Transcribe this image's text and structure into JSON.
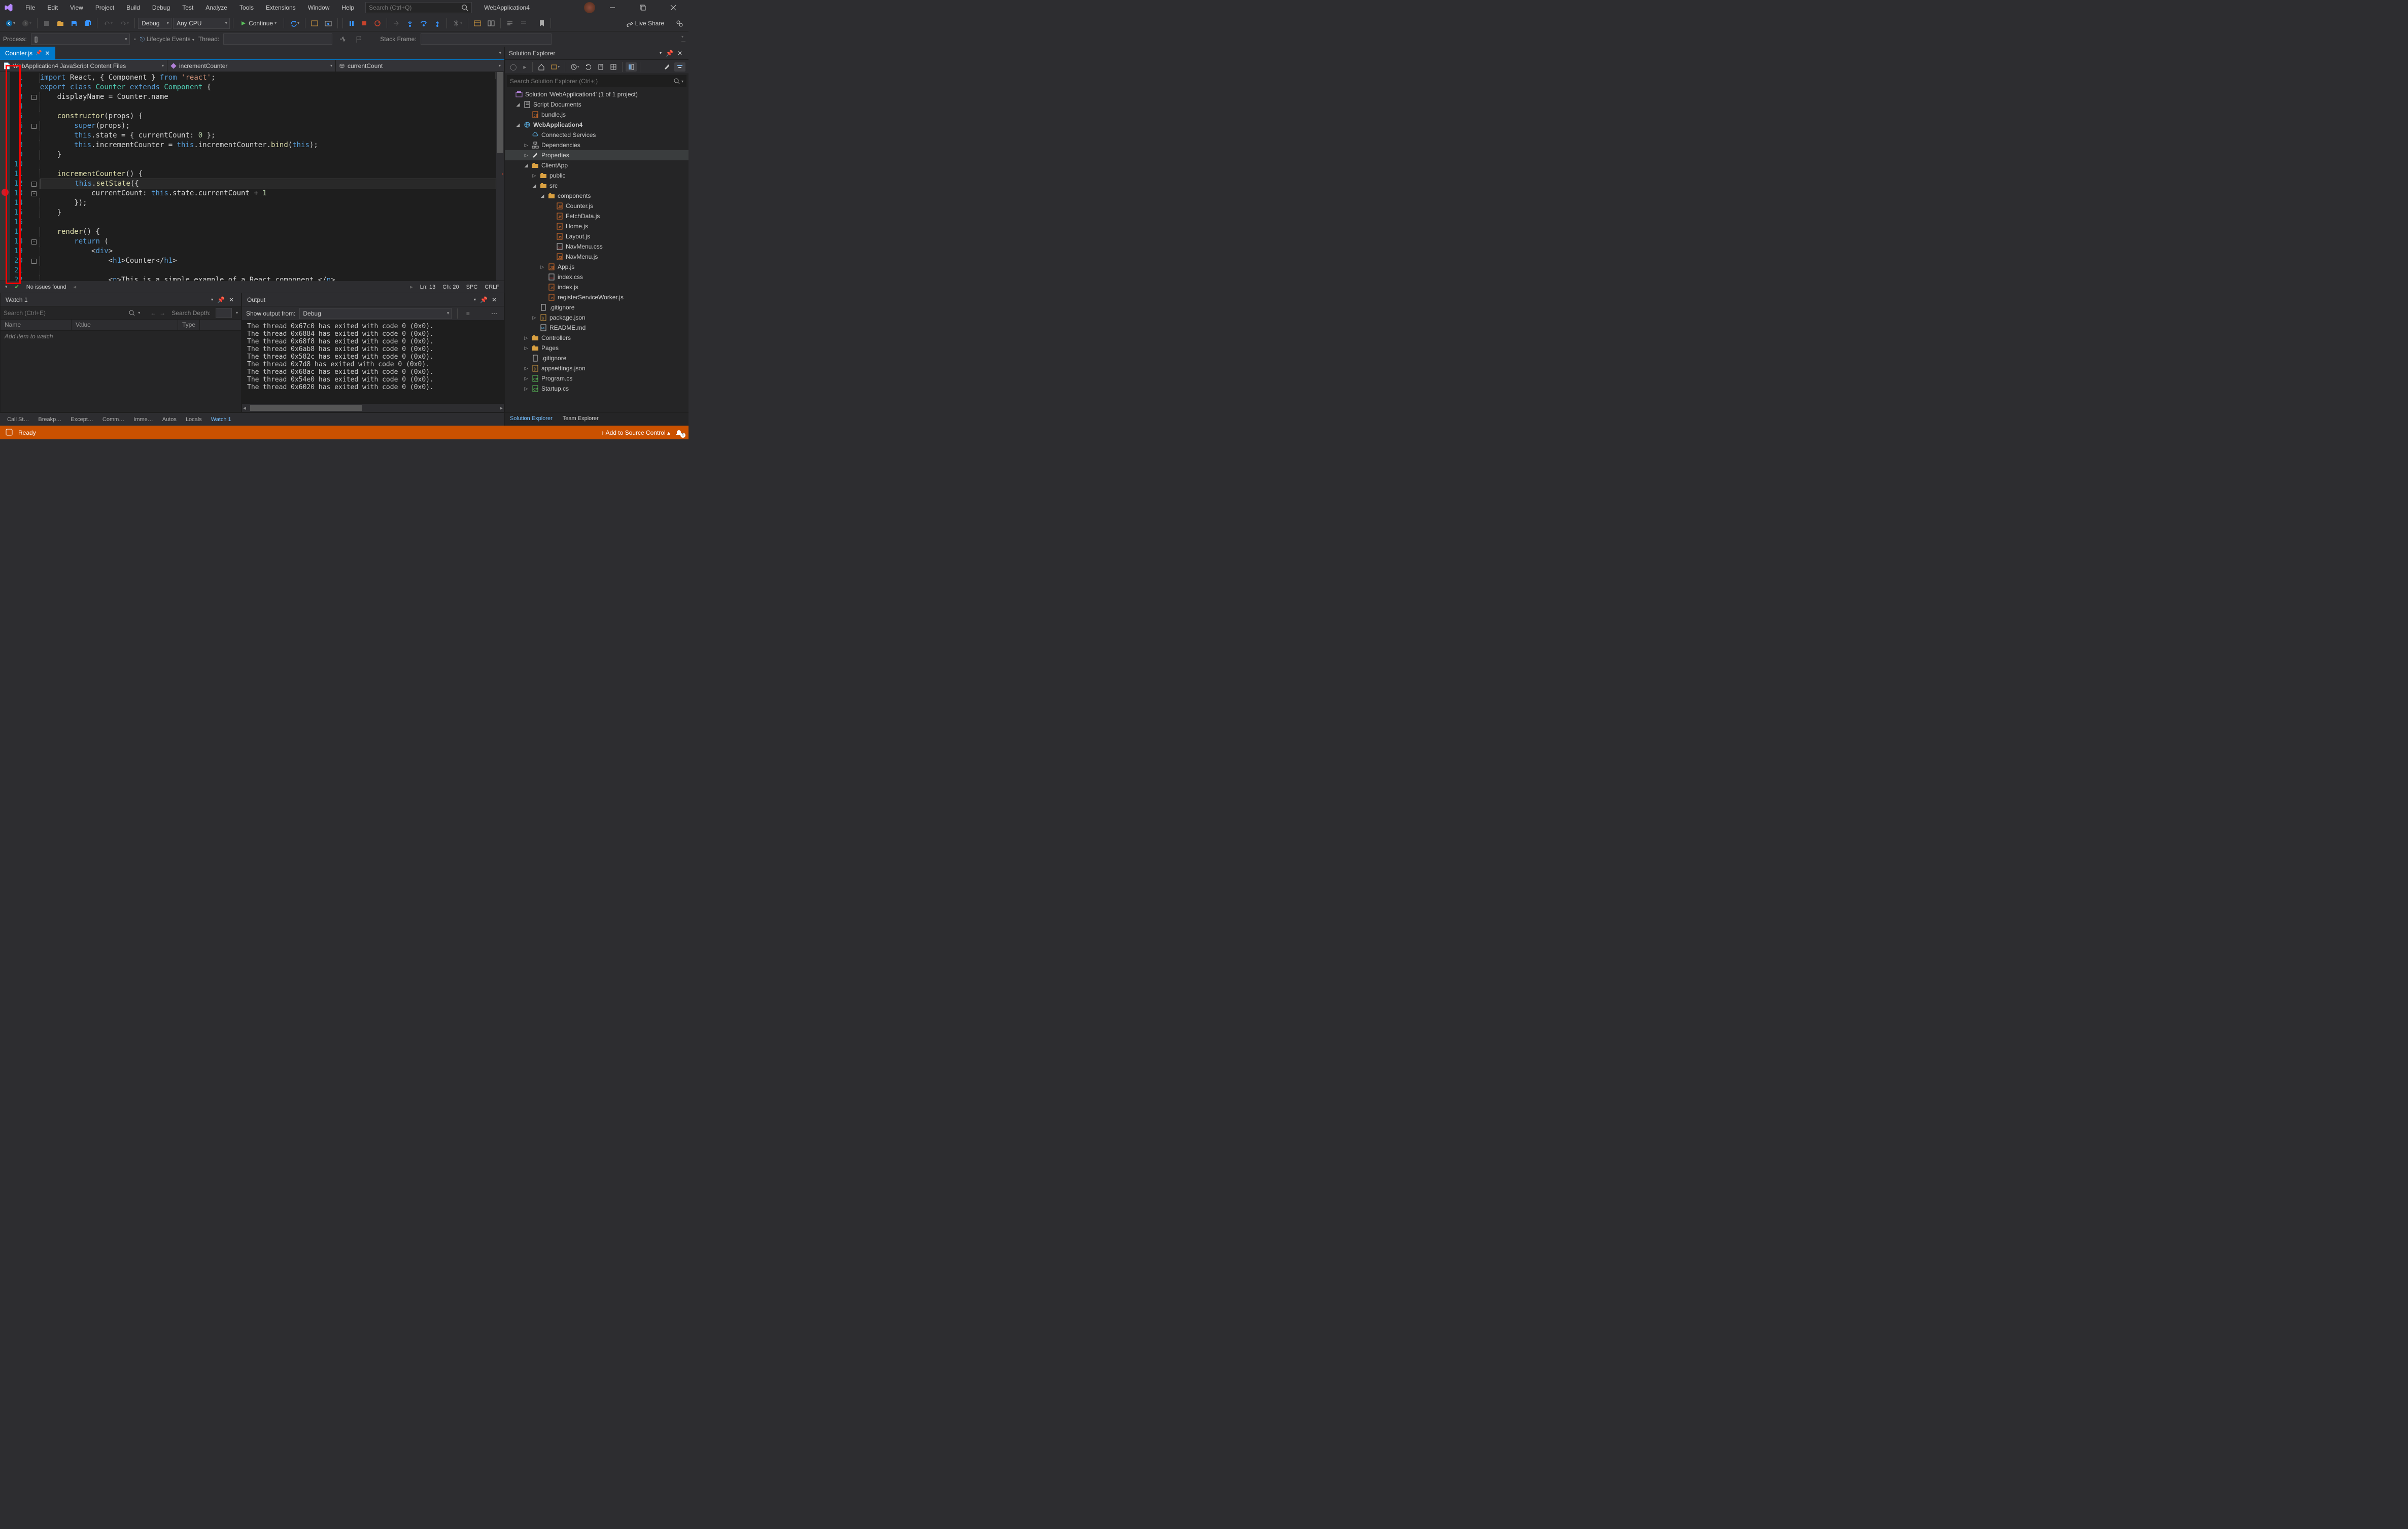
{
  "title": "WebApplication4",
  "menu": [
    "File",
    "Edit",
    "View",
    "Project",
    "Build",
    "Debug",
    "Test",
    "Analyze",
    "Tools",
    "Extensions",
    "Window",
    "Help"
  ],
  "searchPlaceholder": "Search (Ctrl+Q)",
  "toolbar": {
    "configuration": "Debug",
    "platform": "Any CPU",
    "runLabel": "Continue",
    "liveShare": "Live Share"
  },
  "debugBar": {
    "processLabel": "Process:",
    "processValue": "[]",
    "lifecycleLabel": "Lifecycle Events",
    "threadLabel": "Thread:",
    "stackLabel": "Stack Frame:"
  },
  "tab": {
    "name": "Counter.js"
  },
  "navBar": {
    "scope": "WebApplication4 JavaScript Content Files",
    "member": "incrementCounter",
    "field": "currentCount"
  },
  "code": {
    "lines": [
      {
        "n": 1,
        "html": "<span class='kw'>import</span> <span class='txt'>React, { Component }</span> <span class='kw'>from</span> <span class='str'>'react'</span><span class='txt'>;</span>",
        "indent": 0
      },
      {
        "n": 2,
        "html": "",
        "indent": 0
      },
      {
        "n": 3,
        "html": "<span class='kw'>export</span> <span class='kw'>class</span> <span class='type'>Counter</span> <span class='kw'>extends</span> <span class='type'>Component</span> <span class='txt'>{</span>",
        "indent": 0,
        "fold": true
      },
      {
        "n": 4,
        "html": "<span class='txt'>displayName = Counter.name</span>",
        "indent": 1
      },
      {
        "n": 5,
        "html": "",
        "indent": 1
      },
      {
        "n": 6,
        "html": "<span class='fn'>constructor</span><span class='txt'>(props) {</span>",
        "indent": 1,
        "fold": true
      },
      {
        "n": 7,
        "html": "<span class='kw'>super</span><span class='txt'>(props);</span>",
        "indent": 2
      },
      {
        "n": 8,
        "html": "<span class='kw'>this</span><span class='txt'>.state = { currentCount: </span><span class='num'>0</span><span class='txt'> };</span>",
        "indent": 2
      },
      {
        "n": 9,
        "html": "<span class='kw'>this</span><span class='txt'>.incrementCounter = </span><span class='kw'>this</span><span class='txt'>.incrementCounter.</span><span class='fn'>bind</span><span class='txt'>(</span><span class='kw'>this</span><span class='txt'>);</span>",
        "indent": 2
      },
      {
        "n": 10,
        "html": "<span class='txt'>}</span>",
        "indent": 1
      },
      {
        "n": 11,
        "html": "",
        "indent": 1
      },
      {
        "n": 12,
        "html": "<span class='fn'>incrementCounter</span><span class='txt'>() {</span>",
        "indent": 1,
        "fold": true
      },
      {
        "n": 13,
        "html": "<span class='kw'>this</span><span class='txt'>.</span><span class='fn'>setState</span><span class='txt'>({</span>",
        "indent": 2,
        "fold": true,
        "current": true,
        "breakpoint": true
      },
      {
        "n": 14,
        "html": "<span class='txt'>currentCount: </span><span class='kw'>this</span><span class='txt'>.state.currentCount + </span><span class='num'>1</span>",
        "indent": 3
      },
      {
        "n": 15,
        "html": "<span class='txt'>});</span>",
        "indent": 2
      },
      {
        "n": 16,
        "html": "<span class='txt'>}</span>",
        "indent": 1
      },
      {
        "n": 17,
        "html": "",
        "indent": 1
      },
      {
        "n": 18,
        "html": "<span class='fn'>render</span><span class='txt'>() {</span>",
        "indent": 1,
        "fold": true
      },
      {
        "n": 19,
        "html": "<span class='kw'>return</span> <span class='txt'>(</span>",
        "indent": 2
      },
      {
        "n": 20,
        "html": "<span class='txt'>&lt;</span><span class='tag'>div</span><span class='txt'>&gt;</span>",
        "indent": 3,
        "fold": true
      },
      {
        "n": 21,
        "html": "<span class='txt'>&lt;</span><span class='tag'>h1</span><span class='txt'>&gt;Counter&lt;/</span><span class='tag'>h1</span><span class='txt'>&gt;</span>",
        "indent": 4
      },
      {
        "n": 22,
        "html": "",
        "indent": 4
      },
      {
        "n": 23,
        "html": "<span class='txt'>&lt;</span><span class='tag'>n</span><span class='txt'>&gt;This is a simple example of a React component.&lt;/</span><span class='tag'>n</span><span class='txt'>&gt;</span>",
        "indent": 4
      }
    ]
  },
  "editorStatus": {
    "issues": "No issues found",
    "ln": "Ln: 13",
    "ch": "Ch: 20",
    "spc": "SPC",
    "eol": "CRLF"
  },
  "watch": {
    "title": "Watch 1",
    "searchPlaceholder": "Search (Ctrl+E)",
    "depthLabel": "Search Depth:",
    "cols": [
      "Name",
      "Value",
      "Type"
    ],
    "placeholder": "Add item to watch"
  },
  "output": {
    "title": "Output",
    "showLabel": "Show output from:",
    "source": "Debug",
    "lines": [
      "The thread 0x67c0 has exited with code 0 (0x0).",
      "The thread 0x6884 has exited with code 0 (0x0).",
      "The thread 0x68f8 has exited with code 0 (0x0).",
      "The thread 0x6ab8 has exited with code 0 (0x0).",
      "The thread 0x582c has exited with code 0 (0x0).",
      "The thread 0x7d8 has exited with code 0 (0x0).",
      "The thread 0x68ac has exited with code 0 (0x0).",
      "The thread 0x54e0 has exited with code 0 (0x0).",
      "The thread 0x6020 has exited with code 0 (0x0)."
    ]
  },
  "bottomTabs": [
    "Call St…",
    "Breakp…",
    "Except…",
    "Comm…",
    "Imme…",
    "Autos",
    "Locals",
    "Watch 1"
  ],
  "se": {
    "title": "Solution Explorer",
    "searchPlaceholder": "Search Solution Explorer (Ctrl+;)",
    "solution": "Solution 'WebApplication4' (1 of 1 project)",
    "tree": [
      {
        "d": 0,
        "exp": "▲",
        "icon": "sol",
        "label": "Solution 'WebApplication4' (1 of 1 project)",
        "hidden": true
      },
      {
        "d": 1,
        "exp": "▲",
        "icon": "script",
        "label": "Script Documents"
      },
      {
        "d": 2,
        "exp": "",
        "icon": "js",
        "label": "bundle.js"
      },
      {
        "d": 1,
        "exp": "▲",
        "icon": "globe",
        "label": "WebApplication4",
        "bold": true
      },
      {
        "d": 2,
        "exp": "",
        "icon": "cloud",
        "label": "Connected Services"
      },
      {
        "d": 2,
        "exp": "▷",
        "icon": "deps",
        "label": "Dependencies"
      },
      {
        "d": 2,
        "exp": "▷",
        "icon": "wrench",
        "label": "Properties",
        "sel": true
      },
      {
        "d": 2,
        "exp": "▲",
        "icon": "folder",
        "label": "ClientApp"
      },
      {
        "d": 3,
        "exp": "▷",
        "icon": "folder",
        "label": "public"
      },
      {
        "d": 3,
        "exp": "▲",
        "icon": "folder",
        "label": "src"
      },
      {
        "d": 4,
        "exp": "▲",
        "icon": "folder",
        "label": "components"
      },
      {
        "d": 5,
        "exp": "",
        "icon": "js",
        "label": "Counter.js"
      },
      {
        "d": 5,
        "exp": "",
        "icon": "js",
        "label": "FetchData.js"
      },
      {
        "d": 5,
        "exp": "",
        "icon": "js",
        "label": "Home.js"
      },
      {
        "d": 5,
        "exp": "",
        "icon": "js",
        "label": "Layout.js"
      },
      {
        "d": 5,
        "exp": "",
        "icon": "css",
        "label": "NavMenu.css"
      },
      {
        "d": 5,
        "exp": "",
        "icon": "js",
        "label": "NavMenu.js"
      },
      {
        "d": 4,
        "exp": "▷",
        "icon": "js",
        "label": "App.js"
      },
      {
        "d": 4,
        "exp": "",
        "icon": "css",
        "label": "index.css"
      },
      {
        "d": 4,
        "exp": "",
        "icon": "js",
        "label": "index.js"
      },
      {
        "d": 4,
        "exp": "",
        "icon": "js",
        "label": "registerServiceWorker.js"
      },
      {
        "d": 3,
        "exp": "",
        "icon": "file",
        "label": ".gitignore"
      },
      {
        "d": 3,
        "exp": "▷",
        "icon": "json",
        "label": "package.json"
      },
      {
        "d": 3,
        "exp": "",
        "icon": "md",
        "label": "README.md"
      },
      {
        "d": 2,
        "exp": "▷",
        "icon": "folder",
        "label": "Controllers"
      },
      {
        "d": 2,
        "exp": "▷",
        "icon": "folder",
        "label": "Pages"
      },
      {
        "d": 2,
        "exp": "",
        "icon": "file",
        "label": ".gitignore"
      },
      {
        "d": 2,
        "exp": "▷",
        "icon": "json",
        "label": "appsettings.json"
      },
      {
        "d": 2,
        "exp": "▷",
        "icon": "cs",
        "label": "Program.cs"
      },
      {
        "d": 2,
        "exp": "▷",
        "icon": "cs",
        "label": "Startup.cs"
      }
    ],
    "bottomTabs": [
      "Solution Explorer",
      "Team Explorer"
    ]
  },
  "statusbar": {
    "ready": "Ready",
    "source": "Add to Source Control"
  }
}
